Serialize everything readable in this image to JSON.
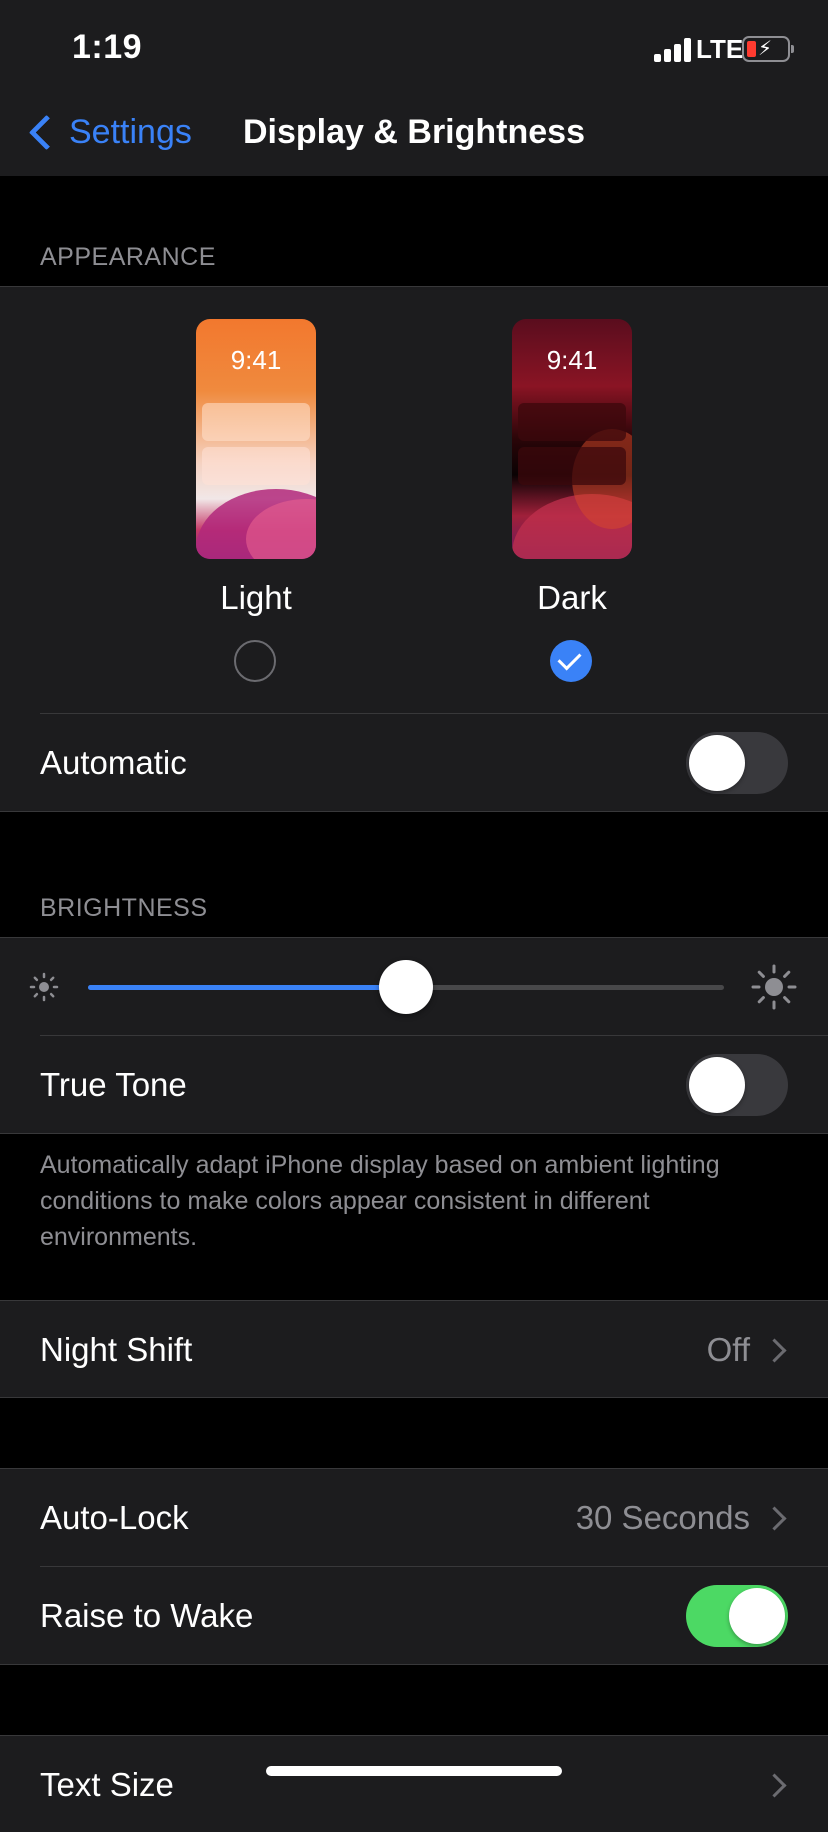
{
  "status_bar": {
    "time": "1:19",
    "network": "LTE",
    "battery_level": 0.2,
    "charging": true
  },
  "nav": {
    "back_label": "Settings",
    "title": "Display & Brightness"
  },
  "appearance": {
    "header": "APPEARANCE",
    "options": [
      {
        "label": "Light",
        "preview_time": "9:41",
        "selected": false
      },
      {
        "label": "Dark",
        "preview_time": "9:41",
        "selected": true
      }
    ],
    "automatic": {
      "label": "Automatic",
      "on": false
    }
  },
  "brightness": {
    "header": "BRIGHTNESS",
    "level": 0.5,
    "true_tone": {
      "label": "True Tone",
      "on": false
    },
    "footnote": "Automatically adapt iPhone display based on ambient lighting conditions to make colors appear consistent in different environments."
  },
  "night_shift": {
    "label": "Night Shift",
    "value": "Off"
  },
  "auto_lock": {
    "label": "Auto-Lock",
    "value": "30 Seconds"
  },
  "raise_to_wake": {
    "label": "Raise to Wake",
    "on": true
  },
  "text_size": {
    "label": "Text Size"
  },
  "colors": {
    "accent": "#3a82f7",
    "toggle_on": "#4cd964",
    "background": "#000000",
    "cell": "#1c1c1e"
  }
}
